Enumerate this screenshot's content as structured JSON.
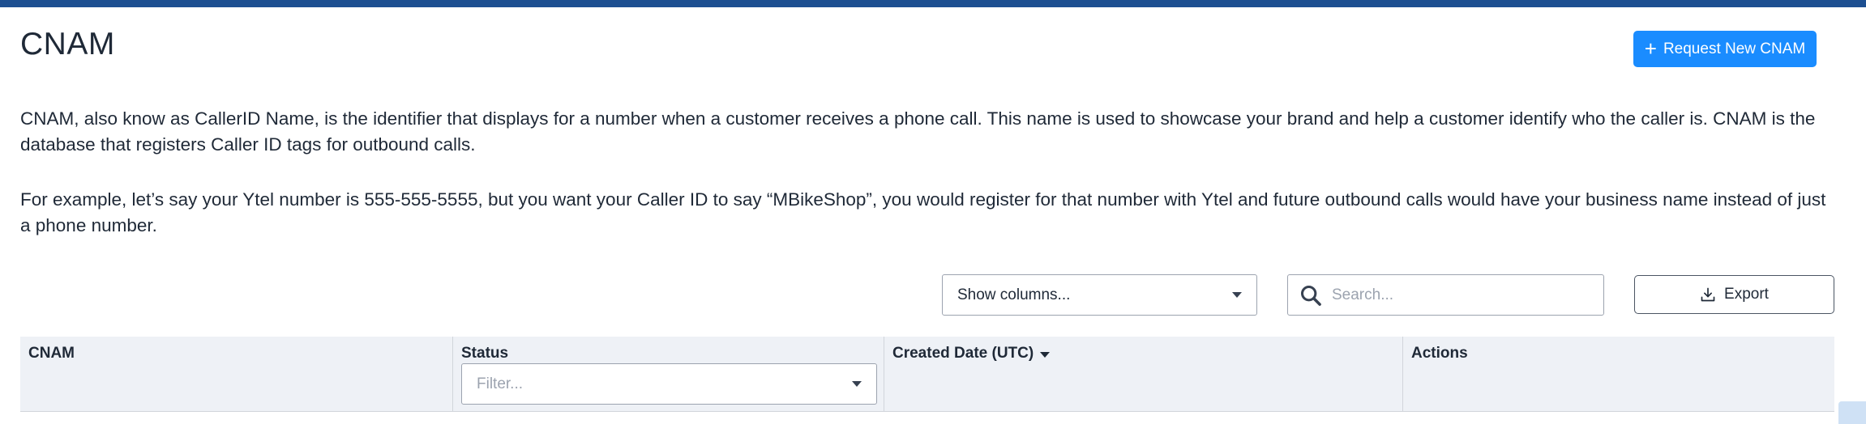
{
  "header": {
    "title": "CNAM",
    "request_button_label": "Request New CNAM"
  },
  "description": {
    "paragraph_1": "CNAM, also know as CallerID Name, is the identifier that displays for a number when a customer receives a phone call. This name is used to showcase your brand and help a customer identify who the caller is. CNAM is the database that registers Caller ID tags for outbound calls.",
    "paragraph_2": "For example, let’s say your Ytel number is 555-555-5555, but you want your Caller ID to say “MBikeShop”, you would register for that number with Ytel and future outbound calls would have your business name instead of just a phone number."
  },
  "toolbar": {
    "columns_select_label": "Show columns...",
    "search_placeholder": "Search...",
    "export_label": "Export"
  },
  "table": {
    "columns": [
      "CNAM",
      "Status",
      "Created Date (UTC)",
      "Actions"
    ],
    "status_filter_placeholder": "Filter..."
  },
  "colors": {
    "topbar": "#1d4f91",
    "primary": "#1a8cff",
    "table_header_bg": "#eef1f6"
  },
  "icons": {
    "request": "plus-icon",
    "columns": "chevron-down-icon",
    "search": "search-icon",
    "export": "download-icon",
    "sort": "sort-desc-icon"
  }
}
